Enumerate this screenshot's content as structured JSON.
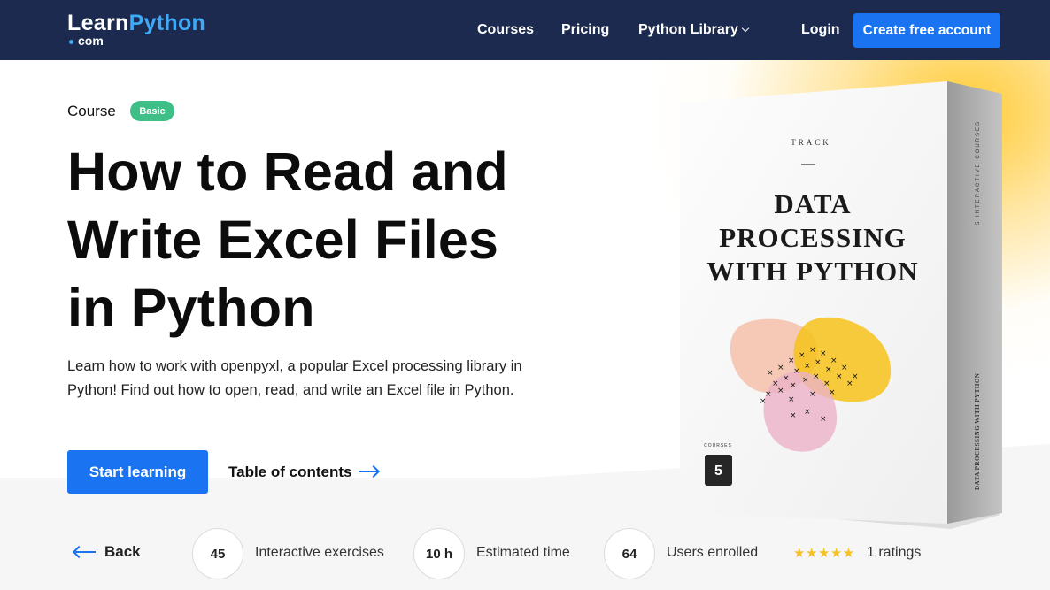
{
  "nav": {
    "logo_main_a": "Learn",
    "logo_main_b": "Python",
    "logo_sub": "com",
    "links": [
      "Courses",
      "Pricing",
      "Python Library"
    ],
    "login": "Login",
    "create_account": "Create free account"
  },
  "hero": {
    "course_label": "Course",
    "badge": "Basic",
    "title_lines": [
      "How to Read and",
      "Write Excel Files",
      "in Python"
    ],
    "description": "Learn how to work with openpyxl, a popular Excel processing library in Python! Find out how to open, read, and write an Excel file in Python.",
    "start_button": "Start learning",
    "toc_link": "Table of contents"
  },
  "product_box": {
    "track": "TRACK",
    "title_lines": [
      "DATA",
      "PROCESSING",
      "WITH PYTHON"
    ],
    "courses_caption": "COURSES",
    "courses_count": "5",
    "spine_top": "5 INTERACTIVE COURSES",
    "spine_bottom": "DATA PROCESSING WITH PYTHON"
  },
  "stats": {
    "back": "Back",
    "exercises_value": "45",
    "exercises_label": "Interactive exercises",
    "time_value": "10 h",
    "time_label": "Estimated time",
    "users_value": "64",
    "users_label": "Users enrolled",
    "stars": "★★★★★",
    "rating_stars": 5,
    "ratings_label": "1 ratings"
  },
  "colors": {
    "nav_bg": "#1b2a4e",
    "accent_blue": "#1a73f0",
    "badge_green": "#3dbf87",
    "star_yellow": "#f4c228"
  }
}
